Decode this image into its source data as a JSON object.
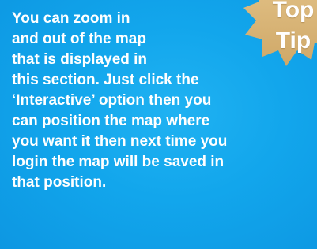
{
  "card": {
    "background": "#13a8ee",
    "text_color": "#ffffff"
  },
  "badge": {
    "line1": "Top",
    "line2": "Tip",
    "fill": "#d9b57a",
    "icon": "top-tip-starburst-icon"
  },
  "body_lines": [
    "You can zoom in",
    "and out of the map",
    "that is displayed in",
    "this section. Just click the",
    "‘Interactive’ option then you",
    "can position the map where",
    "you want it then next time you",
    "login the map will be saved in",
    "that position."
  ]
}
